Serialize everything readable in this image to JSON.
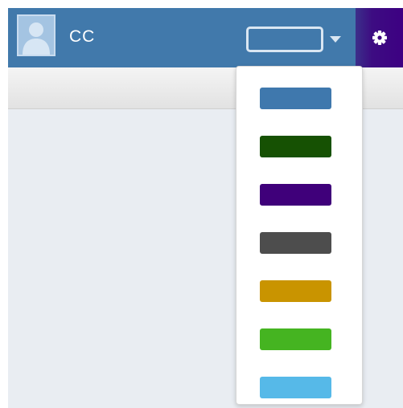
{
  "user": {
    "name": "CC",
    "avatar_icon": "user-silhouette-icon"
  },
  "theme_picker": {
    "selected_value": "",
    "caret_icon": "caret-down-icon",
    "options": [
      {
        "name": "blue",
        "color": "#3f78ad"
      },
      {
        "name": "dark-green",
        "color": "#165103"
      },
      {
        "name": "purple",
        "color": "#3f007a"
      },
      {
        "name": "dark-gray",
        "color": "#4d4d4d"
      },
      {
        "name": "gold",
        "color": "#c99400"
      },
      {
        "name": "green",
        "color": "#45b421"
      },
      {
        "name": "light-blue",
        "color": "#56b9e8"
      }
    ]
  },
  "settings": {
    "icon": "gear-icon"
  },
  "colors": {
    "topbar": "#4179ab",
    "settings_bg": "#3d0082",
    "content_bg": "#e9edf2"
  }
}
